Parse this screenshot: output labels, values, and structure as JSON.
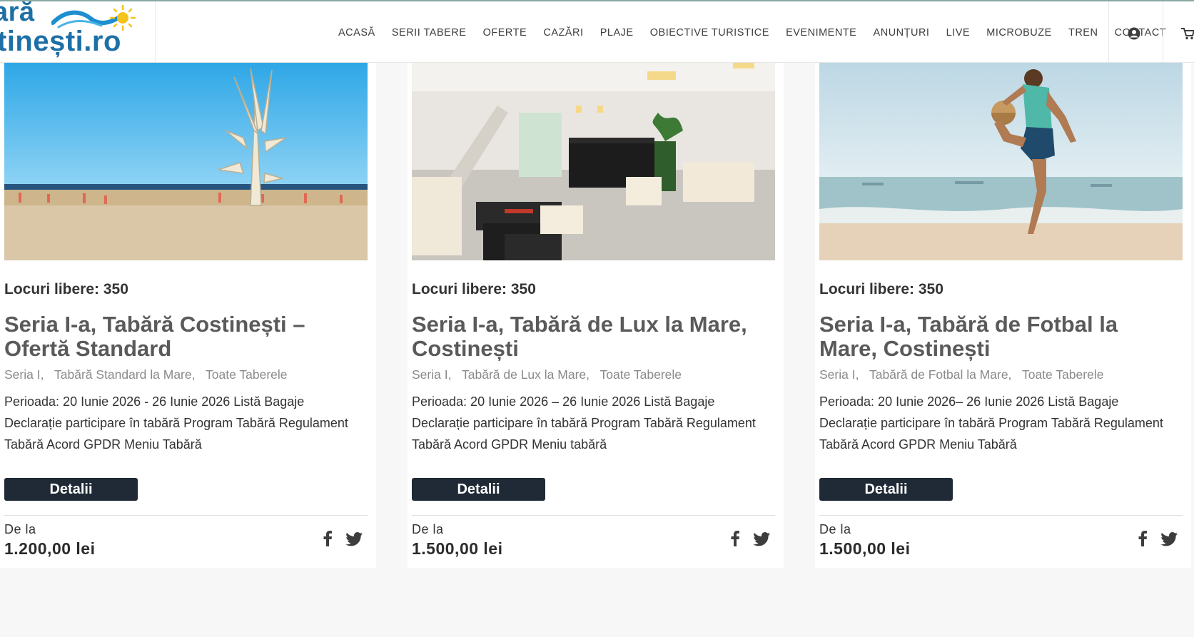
{
  "logo": {
    "line1": "ară",
    "line2": "tinești.ro"
  },
  "nav": {
    "items": [
      "ACASĂ",
      "SERII TABERE",
      "OFERTE",
      "CAZĂRI",
      "PLAJE",
      "OBIECTIVE TURISTICE",
      "EVENIMENTE",
      "ANUNȚURI",
      "LIVE",
      "MICROBUZE",
      "TREN",
      "CONTACT"
    ],
    "user_icon": "user-circle-icon",
    "cart_icon": "shopping-cart-icon"
  },
  "cards": [
    {
      "seats": "Locuri libere: 350",
      "title": "Seria I-a, Tabără Costinești – Ofertă Standard",
      "categories": [
        "Seria I,",
        "Tabără Standard la Mare,",
        "Toate Taberele"
      ],
      "excerpt": "Perioada: 20 Iunie 2026 - 26 Iunie 2026 Listă Bagaje Declarație participare în tabără Program Tabără Regulament Tabără Acord GPDR Meniu Tabără",
      "button": "Detalii",
      "price_from": "De la",
      "price": "1.200,00 lei"
    },
    {
      "seats": "Locuri libere: 350",
      "title": "Seria I-a, Tabără de Lux la Mare, Costinești",
      "categories": [
        "Seria I,",
        "Tabără de Lux la Mare,",
        "Toate Taberele"
      ],
      "excerpt": "Perioada:  20 Iunie 2026 – 26 Iunie 2026 Listă Bagaje Declarație participare în tabără Program Tabără Regulament Tabără Acord GPDR Meniu tabără",
      "button": "Detalii",
      "price_from": "De la",
      "price": "1.500,00 lei"
    },
    {
      "seats": "Locuri libere: 350",
      "title": "Seria I-a, Tabără de Fotbal la Mare, Costinești",
      "categories": [
        "Seria I,",
        "Tabără de Fotbal la Mare,",
        "Toate Taberele"
      ],
      "excerpt": "Perioada: 20 Iunie 2026– 26 Iunie 2026 Listă Bagaje Declarație participare în tabără Program Tabără Regulament Tabără Acord GPDR Meniu Tabără",
      "button": "Detalii",
      "price_from": "De la",
      "price": "1.500,00 lei"
    }
  ],
  "colors": {
    "button_bg": "#1f2a36",
    "logo_blue": "#1d6fa6",
    "page_bg": "#f7f7f7"
  }
}
